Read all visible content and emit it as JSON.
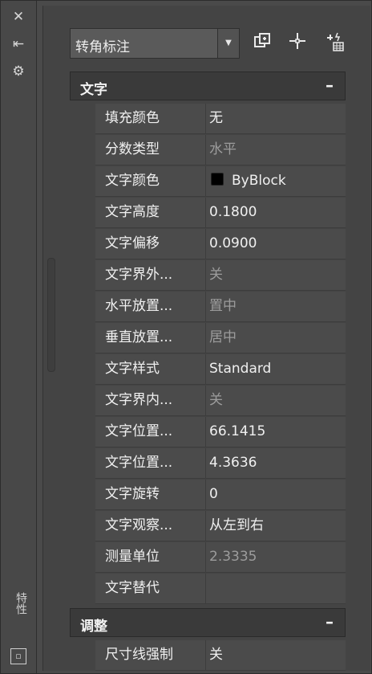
{
  "palette": {
    "title": "特性",
    "close_icon": "close-icon",
    "autohide_icon": "auto-hide-icon",
    "settings_icon": "settings-icon",
    "bottom_icon": "restore-icon"
  },
  "selector": {
    "value": "转角标注",
    "arrow_icon": "dropdown-arrow-icon"
  },
  "toolbar": {
    "buttons": [
      {
        "name": "toggle-pickadd-button",
        "icon": "toggle-pickadd-icon"
      },
      {
        "name": "select-objects-button",
        "icon": "select-objects-icon"
      },
      {
        "name": "quick-select-button",
        "icon": "quick-select-icon"
      }
    ]
  },
  "sections": [
    {
      "title": "文字",
      "collapse": "–",
      "rows": [
        {
          "label": "填充颜色",
          "value": "无",
          "dim": false
        },
        {
          "label": "分数类型",
          "value": "水平",
          "dim": true
        },
        {
          "label": "文字颜色",
          "value": "ByBlock",
          "dim": false,
          "swatch": "#000000"
        },
        {
          "label": "文字高度",
          "value": "0.1800",
          "dim": false
        },
        {
          "label": "文字偏移",
          "value": "0.0900",
          "dim": false
        },
        {
          "label": "文字界外...",
          "value": "关",
          "dim": true
        },
        {
          "label": "水平放置...",
          "value": "置中",
          "dim": true
        },
        {
          "label": "垂直放置...",
          "value": "居中",
          "dim": true
        },
        {
          "label": "文字样式",
          "value": "Standard",
          "dim": false
        },
        {
          "label": "文字界内...",
          "value": "关",
          "dim": true
        },
        {
          "label": "文字位置...",
          "value": "66.1415",
          "dim": false
        },
        {
          "label": "文字位置...",
          "value": "4.3636",
          "dim": false
        },
        {
          "label": "文字旋转",
          "value": "0",
          "dim": false
        },
        {
          "label": "文字观察...",
          "value": "从左到右",
          "dim": false
        },
        {
          "label": "测量单位",
          "value": "2.3335",
          "dim": true
        },
        {
          "label": "文字替代",
          "value": "",
          "dim": false
        }
      ]
    },
    {
      "title": "调整",
      "collapse": "–",
      "rows": [
        {
          "label": "尺寸线强制",
          "value": "关",
          "dim": false
        }
      ]
    }
  ]
}
